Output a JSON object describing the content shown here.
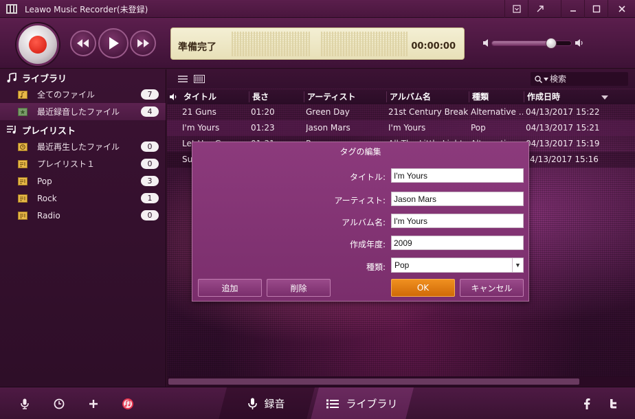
{
  "window": {
    "title": "Leawo Music Recorder(未登録)",
    "controls": [
      "dropdown-icon",
      "open-external-icon",
      "minimize-icon",
      "maximize-icon",
      "close-icon"
    ]
  },
  "player": {
    "status_text": "準備完了",
    "time": "00:00:00",
    "volume_level": 0.75
  },
  "sidebar": {
    "library_heading": "ライブラリ",
    "library_items": [
      {
        "label": "全てのファイル",
        "count": "7"
      },
      {
        "label": "最近録音したファイル",
        "count": "4"
      }
    ],
    "playlist_heading": "プレイリスト",
    "playlist_items": [
      {
        "label": "最近再生したファイル",
        "count": "0"
      },
      {
        "label": "プレイリスト１",
        "count": "0"
      },
      {
        "label": "Pop",
        "count": "3"
      },
      {
        "label": "Rock",
        "count": "1"
      },
      {
        "label": "Radio",
        "count": "0"
      }
    ]
  },
  "list": {
    "search_placeholder": "検索",
    "columns": [
      "タイトル",
      "長さ",
      "アーティスト",
      "アルバム名",
      "種類",
      "作成日時"
    ],
    "rows": [
      {
        "title": "21 Guns",
        "length": "01:20",
        "artist": "Green Day",
        "album": "21st Century Break…",
        "genre": "Alternative …",
        "date": "04/13/2017 15:22"
      },
      {
        "title": "I'm Yours",
        "length": "01:23",
        "artist": "Jason Mars",
        "album": "I'm Yours",
        "genre": "Pop",
        "date": "04/13/2017 15:21"
      },
      {
        "title": "Let Her Go",
        "length": "01:31",
        "artist": "Passenger",
        "album": "All The Little Lights",
        "genre": "Alternative",
        "date": "04/13/2017 15:19"
      },
      {
        "title": "Su",
        "length": "",
        "artist": "",
        "album": "",
        "genre": "",
        "date": "4/13/2017 15:16"
      }
    ]
  },
  "dialog": {
    "title": "タグの編集",
    "fields": [
      {
        "label": "タイトル:",
        "value": "I'm Yours"
      },
      {
        "label": "アーティスト:",
        "value": "Jason Mars"
      },
      {
        "label": "アルバム名:",
        "value": "I'm Yours"
      },
      {
        "label": "作成年度:",
        "value": "2009"
      }
    ],
    "genre_label": "種類:",
    "genre_value": "Pop",
    "add_label": "追加",
    "delete_label": "削除",
    "ok_label": "OK",
    "cancel_label": "キャンセル"
  },
  "bottom": {
    "record_tab": "録音",
    "library_tab": "ライブラリ",
    "icons": [
      "microphone-icon",
      "clock-icon",
      "plus-icon",
      "itunes-icon",
      "facebook-icon",
      "twitter-icon"
    ]
  },
  "colors": {
    "accent": "#d06a08",
    "record_red": "#d0160c",
    "dialog_bg": "#7a2e6c"
  }
}
